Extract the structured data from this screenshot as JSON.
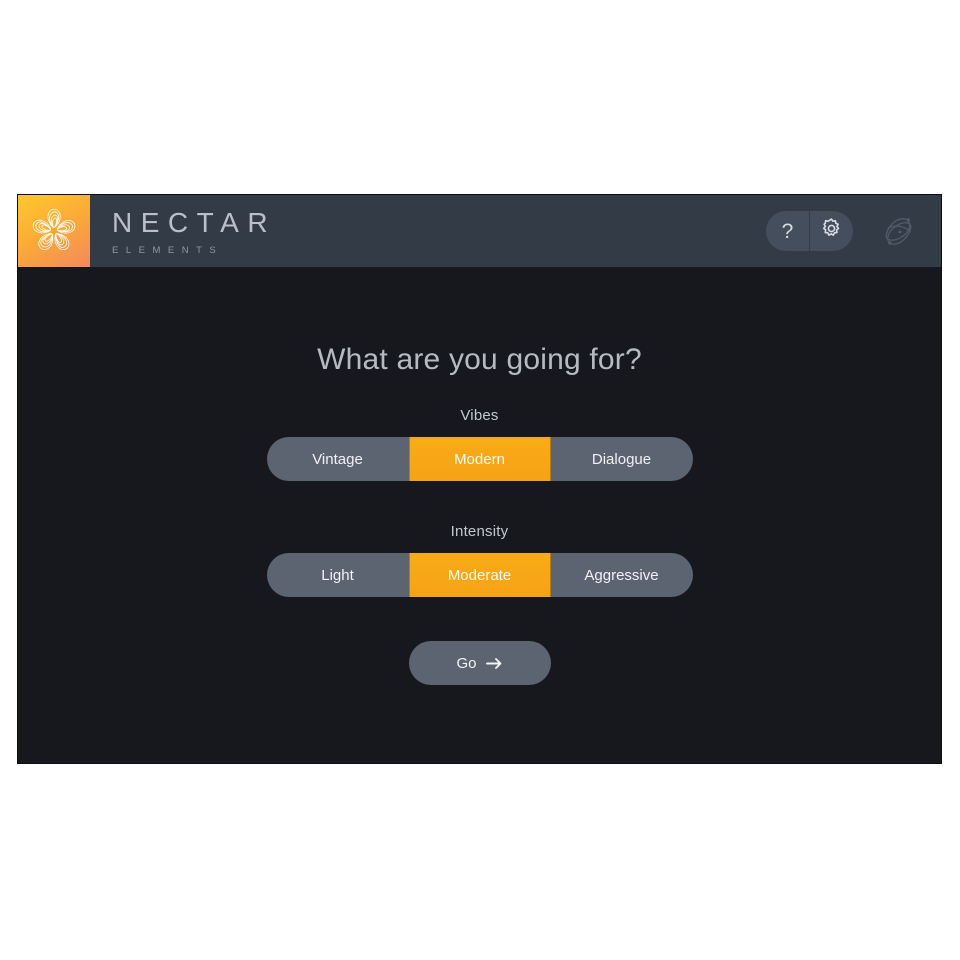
{
  "window": {
    "header": {
      "brand_name": "NECTAR",
      "brand_sub": "ELEMENTS",
      "logo_icon": "nectar-pinwheel-logo",
      "help_label": "?",
      "gear_icon": "gear-icon",
      "vendor_icon": "izotope-logo"
    },
    "main": {
      "title": "What are you going for?",
      "groups": [
        {
          "label": "Vibes",
          "options": [
            {
              "label": "Vintage",
              "selected": false
            },
            {
              "label": "Modern",
              "selected": true
            },
            {
              "label": "Dialogue",
              "selected": false
            }
          ]
        },
        {
          "label": "Intensity",
          "options": [
            {
              "label": "Light",
              "selected": false
            },
            {
              "label": "Moderate",
              "selected": true
            },
            {
              "label": "Aggressive",
              "selected": false
            }
          ]
        }
      ],
      "go_label": "Go",
      "go_arrow_icon": "arrow-right-icon"
    }
  },
  "colors": {
    "accent_orange": "#f5a316",
    "header_bg": "#333b47",
    "body_bg": "#16181e",
    "segment_bg": "#5b6470",
    "pill_bg": "#454e5c",
    "text_light": "#c3c8cf",
    "page_bg": "#ffffff"
  }
}
